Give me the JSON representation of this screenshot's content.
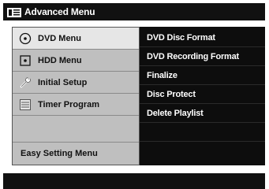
{
  "window": {
    "title": "Advanced Menu",
    "title_icon": "menu-list-icon"
  },
  "left_menu": {
    "items": [
      {
        "label": "DVD Menu",
        "icon": "disc-icon",
        "selected": true
      },
      {
        "label": "HDD Menu",
        "icon": "hdd-icon",
        "selected": false
      },
      {
        "label": "Initial Setup",
        "icon": "wrench-icon",
        "selected": false
      },
      {
        "label": "Timer Program",
        "icon": "list-icon",
        "selected": false
      },
      {
        "label": "",
        "icon": "",
        "selected": false
      },
      {
        "label": "Easy Setting Menu",
        "icon": "",
        "selected": false
      }
    ]
  },
  "right_menu": {
    "items": [
      {
        "label": "DVD Disc Format"
      },
      {
        "label": "DVD Recording Format"
      },
      {
        "label": "Finalize"
      },
      {
        "label": "Disc Protect"
      },
      {
        "label": "Delete Playlist"
      },
      {
        "label": ""
      },
      {
        "label": ""
      }
    ]
  },
  "colors": {
    "titlebar_bg": "#111111",
    "left_panel_bg": "#bfbfbf",
    "selected_bg": "#e6e6e6",
    "right_panel_bg": "#0d0d0d",
    "text_light": "#ffffff",
    "text_dark": "#111111"
  }
}
